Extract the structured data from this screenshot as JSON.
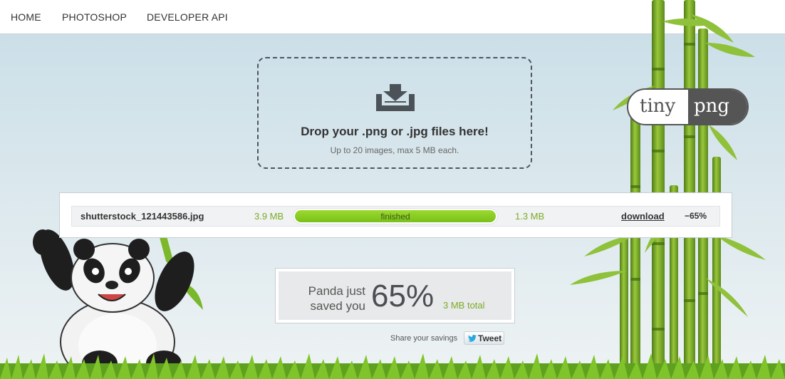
{
  "nav": {
    "items": [
      {
        "label": "HOME"
      },
      {
        "label": "PHOTOSHOP"
      },
      {
        "label": "DEVELOPER API"
      }
    ]
  },
  "dropzone": {
    "icon": "download-tray-icon",
    "title": "Drop your .png or .jpg files here!",
    "subtitle": "Up to 20 images, max 5 MB each."
  },
  "results": [
    {
      "filename": "shutterstock_121443586.jpg",
      "original_size": "3.9 MB",
      "status": "finished",
      "progress": 1.0,
      "compressed_size": "1.3 MB",
      "download_label": "download",
      "reduction": "−65%"
    }
  ],
  "savings": {
    "caption": "Panda just saved you",
    "percent": "65%",
    "total": "3 MB total"
  },
  "share": {
    "label": "Share your savings",
    "tweet_label": "Tweet",
    "tweet_icon": "twitter-bird-icon"
  },
  "logo": {
    "part1": "tiny",
    "part2": "png"
  },
  "colors": {
    "accent_green": "#7cab26",
    "progress_green": "#8ccf25",
    "text_dark": "#333333"
  }
}
